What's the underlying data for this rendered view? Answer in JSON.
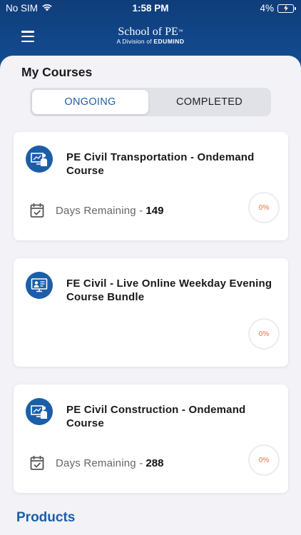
{
  "status_bar": {
    "carrier": "No SIM",
    "time": "1:58 PM",
    "battery": "4%"
  },
  "header": {
    "brand_name": "School of PE",
    "brand_tm": "™",
    "brand_sub_prefix": "A Division of ",
    "brand_sub_company": "EDUMIND",
    "menu_icon": "hamburger-menu-icon"
  },
  "my_courses": {
    "title": "My Courses",
    "tabs": {
      "ongoing": "ONGOING",
      "completed": "COMPLETED",
      "selected": "ongoing"
    },
    "courses": [
      {
        "title": "PE Civil Transportation - Ondemand Course",
        "icon": "person-presentation-icon",
        "days_label": "Days Remaining - ",
        "days_value": "149",
        "progress": "0%"
      },
      {
        "title": "FE Civil - Live Online Weekday Evening Course Bundle",
        "icon": "live-class-icon",
        "progress": "0%"
      },
      {
        "title": "PE Civil Construction - Ondemand Course",
        "icon": "person-presentation-icon",
        "days_label": "Days Remaining - ",
        "days_value": "288",
        "progress": "0%"
      }
    ]
  },
  "products": {
    "title": "Products"
  },
  "colors": {
    "brand_blue": "#155199",
    "accent_blue": "#1b5ea8",
    "progress_orange": "#e2733a",
    "panel_bg": "#f2f2f7"
  }
}
